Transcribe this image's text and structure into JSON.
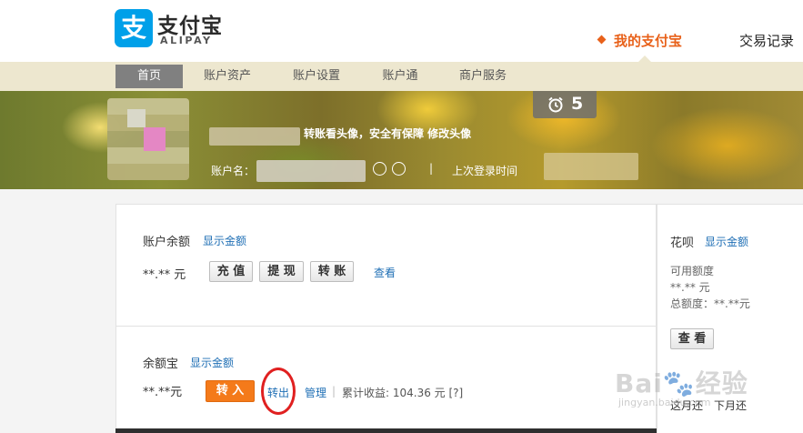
{
  "header": {
    "logo_glyph": "支",
    "logo_cn": "支付宝",
    "logo_en": "ALIPAY",
    "my_alipay": "我的支付宝",
    "trade_records": "交易记录"
  },
  "nav": {
    "items": [
      {
        "label": "首页",
        "active": true
      },
      {
        "label": "账户资产",
        "active": false
      },
      {
        "label": "账户设置",
        "active": false
      },
      {
        "label": "账户通",
        "active": false
      },
      {
        "label": "商户服务",
        "active": false
      }
    ]
  },
  "banner": {
    "alarm_icon": "alarm-clock-icon",
    "alarm_count": "5",
    "modify_avatar_hint": "转账看头像，安全有保障 修改头像",
    "account_name_label": "账户名：",
    "separator": "|",
    "last_login_label": "上次登录时间"
  },
  "balance": {
    "label": "账户余额",
    "show_amount": "显示金额",
    "amount": "**.** 元",
    "recharge": "充 值",
    "withdraw": "提 现",
    "transfer": "转 账",
    "view": "查看"
  },
  "yuebao": {
    "label": "余额宝",
    "show_amount": "显示金额",
    "amount": "**.**元",
    "transfer_in": "转 入",
    "transfer_out": "转出",
    "manage": "管理",
    "separator": "|",
    "earnings": "累计收益: 104.36 元 [?]"
  },
  "huabei": {
    "label": "花呗",
    "show_amount": "显示金额",
    "available_label": "可用额度",
    "available_amount": "**.** 元",
    "total_label": "总额度：**.**元",
    "view_button": "查 看",
    "this_month": "这月还",
    "next_month": "下月还"
  },
  "watermark": {
    "text": "Bai🐾经验",
    "sub": "jingyan.baidu.com"
  },
  "colors": {
    "brand_blue": "#00a0e9",
    "accent_orange": "#e8611a",
    "nav_bg": "#ede7cf",
    "link_blue": "#1f6fb5",
    "annotation_red": "#e02020"
  }
}
